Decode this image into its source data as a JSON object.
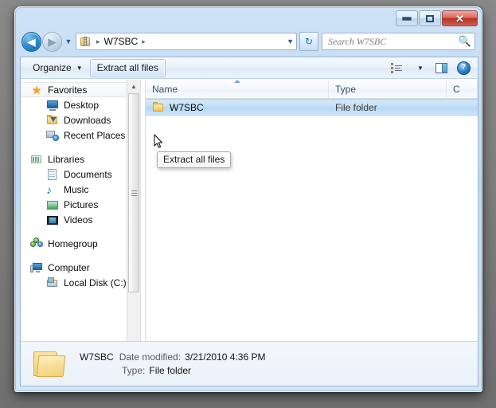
{
  "window": {
    "title": "",
    "caption_buttons": {
      "minimize": "–",
      "maximize": "□",
      "close": "✕"
    }
  },
  "address_bar": {
    "back_label": "◄",
    "forward_label": "►",
    "recent_pages_label": "▼",
    "folder_icon": "zipped-folder-icon",
    "crumbs": [
      "W7SBC"
    ],
    "separator": "▸",
    "dropdown_label": "▼",
    "refresh_label": "↻"
  },
  "search": {
    "placeholder": "Search W7SBC",
    "icon": "magnifier-icon"
  },
  "command_bar": {
    "organize_label": "Organize",
    "organize_caret": "▼",
    "extract_label": "Extract all files",
    "views_caret": "▼",
    "views_icon": "change-view-icon",
    "preview_icon": "show-preview-pane-icon",
    "help_icon": "help-icon",
    "help_glyph": "?"
  },
  "tooltip": {
    "text": "Extract all files"
  },
  "sidebar": {
    "groups": [
      {
        "header": {
          "label": "Favorites",
          "icon": "star-icon",
          "hover": true
        },
        "items": [
          {
            "label": "Desktop",
            "icon": "desktop-icon"
          },
          {
            "label": "Downloads",
            "icon": "downloads-folder-icon"
          },
          {
            "label": "Recent Places",
            "icon": "recent-places-icon"
          }
        ]
      },
      {
        "header": {
          "label": "Libraries",
          "icon": "libraries-icon",
          "hover": false
        },
        "items": [
          {
            "label": "Documents",
            "icon": "documents-icon"
          },
          {
            "label": "Music",
            "icon": "music-icon"
          },
          {
            "label": "Pictures",
            "icon": "pictures-icon"
          },
          {
            "label": "Videos",
            "icon": "videos-icon"
          }
        ]
      },
      {
        "header": {
          "label": "Homegroup",
          "icon": "homegroup-icon",
          "hover": false
        },
        "items": []
      },
      {
        "header": {
          "label": "Computer",
          "icon": "computer-icon",
          "hover": false
        },
        "items": [
          {
            "label": "Local Disk (C:)",
            "icon": "local-disk-icon"
          }
        ]
      }
    ],
    "scroll_up": "▲",
    "scroll_down": "▼"
  },
  "file_list": {
    "columns": [
      {
        "label": "Name",
        "sorted": true
      },
      {
        "label": "Type",
        "sorted": false
      },
      {
        "label": "C",
        "sorted": false
      }
    ],
    "rows": [
      {
        "name": "W7SBC",
        "type": "File folder",
        "compressed": "",
        "icon": "folder-icon",
        "selected": true
      }
    ],
    "hscroll_left": "◄",
    "hscroll_right": "►"
  },
  "details_pane": {
    "icon": "folder-icon-large",
    "name": "W7SBC",
    "date_modified_label": "Date modified:",
    "date_modified_value": "3/21/2010 4:36 PM",
    "type_label": "Type:",
    "type_value": "File folder"
  },
  "colors": {
    "aero_frame": "#c3dcf5",
    "selection": "#bcd8f3",
    "column_header_text": "#33526d",
    "close_button": "#b53326",
    "folder_yellow": "#f7d884"
  }
}
